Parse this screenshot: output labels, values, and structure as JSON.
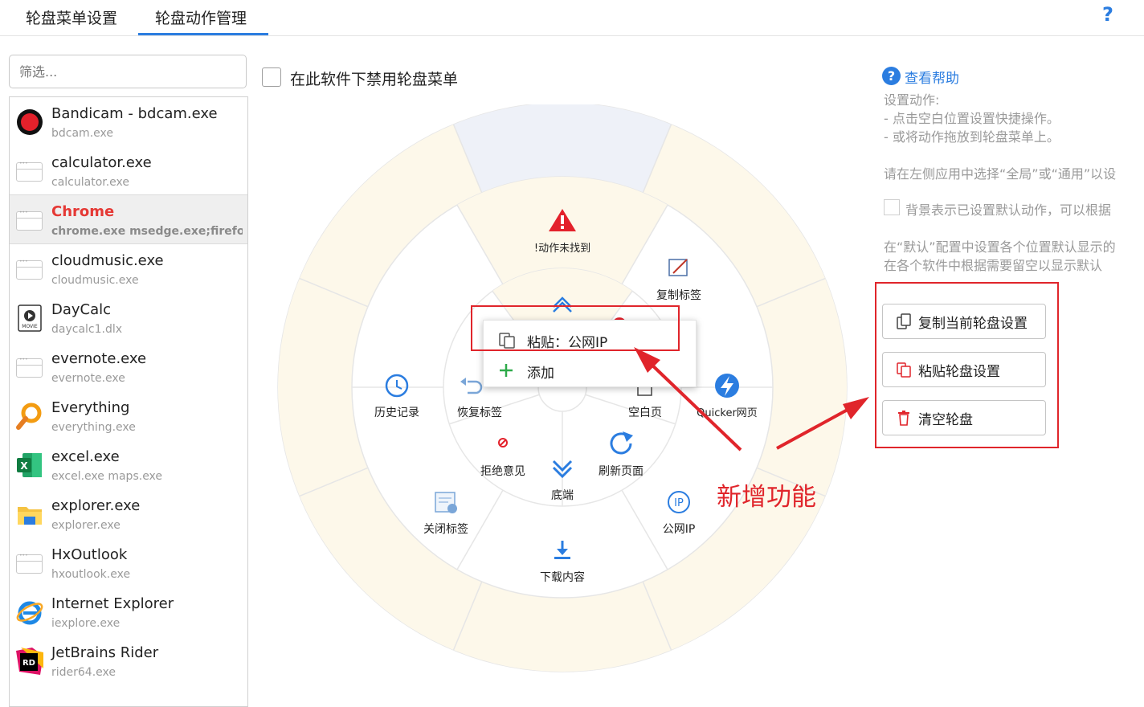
{
  "tabs": [
    {
      "label": "轮盘菜单设置",
      "active": false
    },
    {
      "label": "轮盘动作管理",
      "active": true
    }
  ],
  "help_button": "?",
  "filter": {
    "placeholder": "筛选..."
  },
  "apps": [
    {
      "name": "Bandicam - bdcam.exe",
      "exe": "bdcam.exe",
      "icon": "bandicam-icon"
    },
    {
      "name": "calculator.exe",
      "exe": "calculator.exe",
      "icon": "window-icon"
    },
    {
      "name": "Chrome",
      "exe": "chrome.exe  msedge.exe;firefox",
      "icon": "window-icon",
      "selected": true
    },
    {
      "name": "cloudmusic.exe",
      "exe": "cloudmusic.exe",
      "icon": "window-icon"
    },
    {
      "name": "DayCalc",
      "exe": "daycalc1.dlx",
      "icon": "movie-icon"
    },
    {
      "name": "evernote.exe",
      "exe": "evernote.exe",
      "icon": "window-icon"
    },
    {
      "name": "Everything",
      "exe": "everything.exe",
      "icon": "magnifier-icon"
    },
    {
      "name": "excel.exe",
      "exe": "excel.exe  maps.exe",
      "icon": "excel-icon"
    },
    {
      "name": "explorer.exe",
      "exe": "explorer.exe",
      "icon": "folder-icon"
    },
    {
      "name": "HxOutlook",
      "exe": "hxoutlook.exe",
      "icon": "window-icon"
    },
    {
      "name": "Internet Explorer",
      "exe": "iexplore.exe",
      "icon": "ie-icon"
    },
    {
      "name": "JetBrains Rider",
      "exe": "rider64.exe",
      "icon": "rider-icon"
    }
  ],
  "disable_checkbox": {
    "label": "在此软件下禁用轮盘菜单",
    "checked": false
  },
  "wheel": {
    "inner_up_icon": "chevron-up-icon",
    "items": [
      {
        "label": "!动作未找到",
        "icon": "warning-icon"
      },
      {
        "label": "复制标签",
        "icon": "copy-tab-icon"
      },
      {
        "label": "Quicker网页",
        "icon": "lightning-icon"
      },
      {
        "label": "公网IP",
        "icon": "ip-icon"
      },
      {
        "label": "下载内容",
        "icon": "download-icon"
      },
      {
        "label": "关闭标签",
        "icon": "close-tab-icon"
      },
      {
        "label": "历史记录",
        "icon": "history-icon"
      },
      {
        "label": "恢复标签",
        "icon": "restore-tab-icon"
      },
      {
        "label": "空白页",
        "icon": "blank-page-icon"
      },
      {
        "label": "刷新页面",
        "icon": "refresh-icon"
      },
      {
        "label": "底端",
        "icon": "chevron-double-down-icon"
      },
      {
        "label": "拒绝意见",
        "icon": "reject-icon"
      }
    ]
  },
  "context_menu": {
    "items": [
      {
        "label": "粘贴：公网IP",
        "icon": "paste-icon"
      },
      {
        "label": "添加",
        "icon": "plus-icon"
      }
    ]
  },
  "right_panel": {
    "help_link": "查看帮助",
    "lines": [
      "设置动作:",
      "- 点击空白位置设置快捷操作。",
      "- 或将动作拖放到轮盘菜单上。",
      "请在左侧应用中选择“全局”或“通用”以设",
      "背景表示已设置默认动作，可以根据",
      "在“默认”配置中设置各个位置默认显示的",
      "在各个软件中根据需要留空以显示默认"
    ],
    "buttons": [
      {
        "label": "复制当前轮盘设置",
        "icon": "copy-icon"
      },
      {
        "label": "粘贴轮盘设置",
        "icon": "paste-icon"
      },
      {
        "label": "清空轮盘",
        "icon": "trash-icon"
      }
    ]
  },
  "annotation": "新增功能",
  "colors": {
    "accent": "#2b7de0",
    "highlight_red": "#e0252b",
    "segment_fill": "#fdf8ea"
  }
}
